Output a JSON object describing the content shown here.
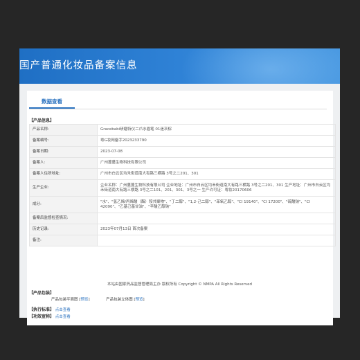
{
  "header": {
    "title": "国产普通化妆品备案信息"
  },
  "tab": {
    "label": "数据查看"
  },
  "product_info": {
    "section_title": "【产品信息】",
    "rows": [
      {
        "label": "产品名称:",
        "value": "Gracebabi研磨特仪二爪水眉笔 01迷灰棕"
      },
      {
        "label": "备案编号:",
        "value": "粤G妆网备字2023233790"
      },
      {
        "label": "备案日期:",
        "value": "2023-07-08"
      },
      {
        "label": "备案人:",
        "value": "广州蔓蔓生物科技有限公司"
      },
      {
        "label": "备案人住所地址:",
        "value": "广州市白云区均禾街道南大有路三横路 3号之二201、301"
      },
      {
        "label": "生产企业:",
        "value": "企业名称：广州蔓蔓生物科技有限公司 企业地址：广州市白云区均禾街道南大有路三横路 3号之二201、301 生产地址：广州市白云区均禾街道南大有路三横路 3号之二101、201、301、3号之一 生产许可证：粤妆20170606"
      },
      {
        "label": "成分:",
        "value": "\"水\"、\"氢乙烯/丙烯酸（酯）铵共聚物\"、\"丁二醇\"、\"1,2-己二醇\"、\"苯氧乙醇\"、\"CI 19140\"、\"CI 17200\"、\"硫酸钠\"、\"CI 42090\"、\"乙基己基甘油\"、\"辛酸乙醇钠\""
      },
      {
        "label": "备案后监督检查情况:",
        "value": ""
      },
      {
        "label": "历史记录:",
        "value": "2023年07月13日 首次备案"
      },
      {
        "label": "备注:",
        "value": ""
      }
    ]
  },
  "packaging": {
    "section_title": "【产品包装】",
    "flat_label": "产品包装平面图",
    "flat_link": "预览",
    "solid_label": "产品包装立体图",
    "solid_link": "预览"
  },
  "standard": {
    "section_title": "【执行标准】",
    "link": "点击查看"
  },
  "efficacy": {
    "section_title": "【功效宣称】",
    "link": "点击查看"
  },
  "footer": {
    "text": "本站由国家药品监督管理局主办 版权所有 Copyright © NMPA All Rights Reserved"
  }
}
